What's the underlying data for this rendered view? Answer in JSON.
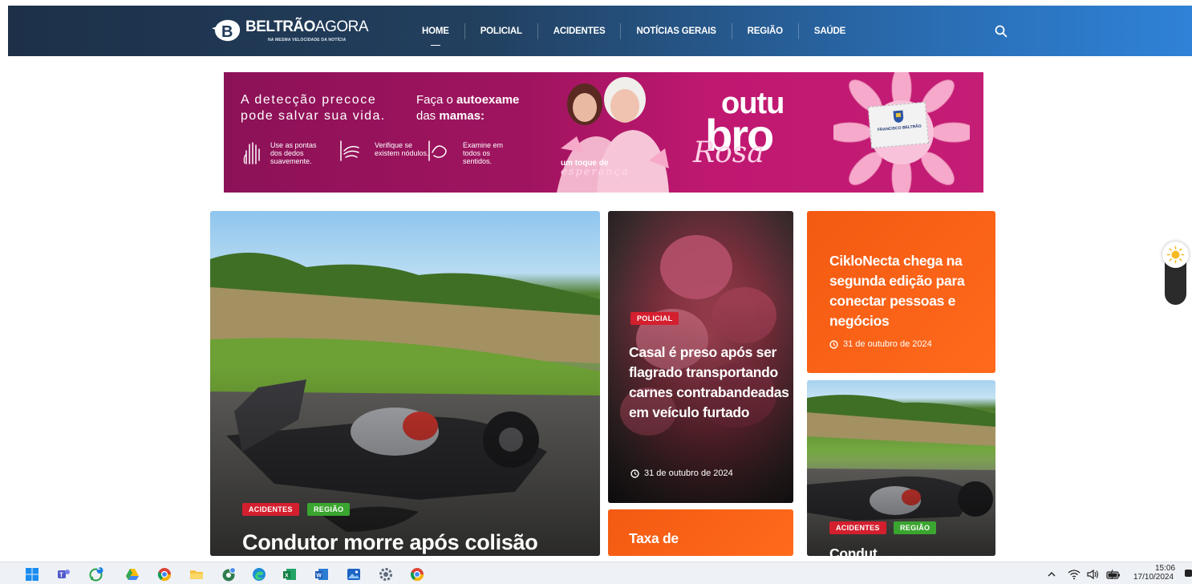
{
  "header": {
    "logo_main": "BELTRÃO",
    "logo_rest": "AGORA",
    "logo_tagline": "NA MESMA VELOCIDADE DA NOTÍCIA",
    "nav": [
      {
        "label": "HOME",
        "active": true
      },
      {
        "label": "POLICIAL",
        "active": false
      },
      {
        "label": "ACIDENTES",
        "active": false
      },
      {
        "label": "NOTÍCIAS GERAIS",
        "active": false
      },
      {
        "label": "REGIÃO",
        "active": false
      },
      {
        "label": "SAÚDE",
        "active": false
      }
    ],
    "search_icon": "search-icon"
  },
  "banner": {
    "line1": "A detecção precoce",
    "line2": "pode salvar sua vida.",
    "cta1_pre": "Faça o ",
    "cta1_bold": "autoexame",
    "cta2_pre": "das ",
    "cta2_bold": "mamas:",
    "steps": [
      "Use as pontas dos dedos suavemente.",
      "Verifique se existem nódulos.",
      "Examine em todos os sentidos."
    ],
    "toque": "um toque de",
    "esperanca": "esperança",
    "outu": "outu",
    "bro": "bro",
    "rosa": "Rosa",
    "seal_text": "FRANCISCO BELTRÃO"
  },
  "cards": {
    "big": {
      "badges": [
        "ACIDENTES",
        "REGIÃO"
      ],
      "title": "Condutor morre após colisão"
    },
    "mid": {
      "badge": "POLICIAL",
      "title": "Casal é preso após ser flagrado transportando carnes contrabandeadas em veículo furtado",
      "date": "31 de outubro de 2024"
    },
    "orange1": {
      "title": "CikloNecta chega na segunda edição para conectar pessoas e negócios",
      "date": "31 de outubro de 2024"
    },
    "orange2": {
      "title": "Taxa de"
    },
    "small": {
      "badges": [
        "ACIDENTES",
        "REGIÃO"
      ],
      "title": "Condut"
    }
  },
  "colors": {
    "header_start": "#1d3048",
    "header_end": "#2f82d8",
    "accent_orange": "#ff6a1c",
    "badge_red": "#d41f2e",
    "badge_green": "#3aa52f",
    "banner_pink": "#c01871"
  },
  "taskbar": {
    "icons": [
      "windows-start-icon",
      "teams-icon",
      "whatsapp-icon",
      "google-drive-icon",
      "chrome-icon",
      "file-explorer-icon",
      "chrome-profile-icon",
      "edge-icon",
      "excel-icon",
      "word-icon",
      "photos-icon",
      "settings-icon",
      "chrome-alt-icon"
    ],
    "time": "15:06",
    "date": "17/10/2024",
    "whatsapp_badge": "2"
  }
}
